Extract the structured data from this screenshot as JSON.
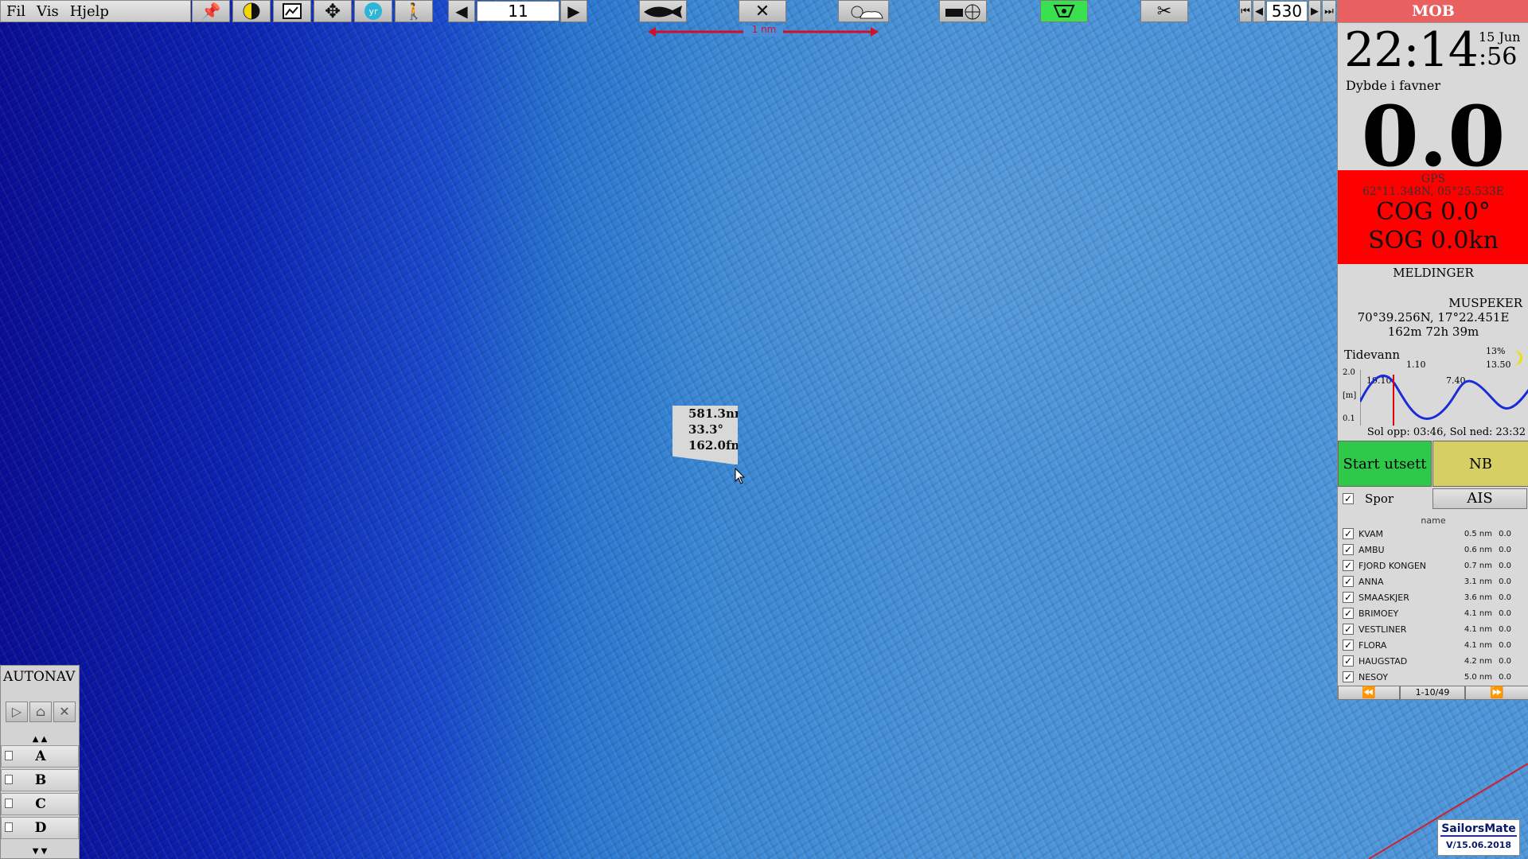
{
  "menu": [
    "Fil",
    "Vis",
    "Hjelp"
  ],
  "toolbar": {
    "zoom_value": "11",
    "page_value": "530",
    "scale_label": "1 nm"
  },
  "panel": {
    "mob": "MOB",
    "time_main": "22:14",
    "time_date": "15 Jun",
    "time_secs": ":56",
    "depth_label": "Dybde i favner",
    "depth_value": "0.0",
    "gps_label": "GPS",
    "gps_coords": "62°11.348N, 05°25.533E",
    "cog": "COG 0.0°",
    "sog": "SOG 0.0kn",
    "messages": "MELDINGER",
    "mouse_label": "MUSPEKER",
    "mouse_coords": "70°39.256N, 17°22.451E",
    "mouse_info": "162m  72h 39m",
    "tide_label": "Tidevann",
    "tide_pct": "13%",
    "tide_y_top": "2.0",
    "tide_y_unit": "[m]",
    "tide_y_bot": "0.1",
    "tide_times": [
      "19.10",
      "1.10",
      "7.40",
      "13.50"
    ],
    "sun_text": "Sol opp: 03:46, Sol ned: 23:32",
    "start_button": "Start utsett",
    "nb_button": "NB",
    "spor_label": "Spor",
    "ais_button": "AIS",
    "ais_col_header": "name",
    "pager_label": "1-10/49"
  },
  "ais_list": [
    {
      "name": "KVAM",
      "dist": "0.5 nm",
      "speed": "0.0"
    },
    {
      "name": "AMBU",
      "dist": "0.6 nm",
      "speed": "0.0"
    },
    {
      "name": "FJORD KONGEN",
      "dist": "0.7 nm",
      "speed": "0.0"
    },
    {
      "name": "ANNA",
      "dist": "3.1 nm",
      "speed": "0.0"
    },
    {
      "name": "SMAASKJER",
      "dist": "3.6 nm",
      "speed": "0.0"
    },
    {
      "name": "BRIMOEY",
      "dist": "4.1 nm",
      "speed": "0.0"
    },
    {
      "name": "VESTLINER",
      "dist": "4.1 nm",
      "speed": "0.0"
    },
    {
      "name": "FLORA",
      "dist": "4.1 nm",
      "speed": "0.0"
    },
    {
      "name": "HAUGSTAD",
      "dist": "4.2 nm",
      "speed": "0.0"
    },
    {
      "name": "NESOY",
      "dist": "5.0 nm",
      "speed": "0.0"
    }
  ],
  "autonav": {
    "title": "AUTONAV",
    "rows": [
      "A",
      "B",
      "C",
      "D"
    ]
  },
  "tooltip": {
    "distance": "581.3nm",
    "bearing": "33.3°",
    "depth": "162.0fm"
  },
  "logo": {
    "name": "SailorsMate",
    "version": "V/15.06.2018"
  },
  "colors": {
    "mob": "#e86060",
    "gps_bg": "#ff0000",
    "start_btn": "#2ec84a",
    "nb_btn": "#d6cf63"
  }
}
